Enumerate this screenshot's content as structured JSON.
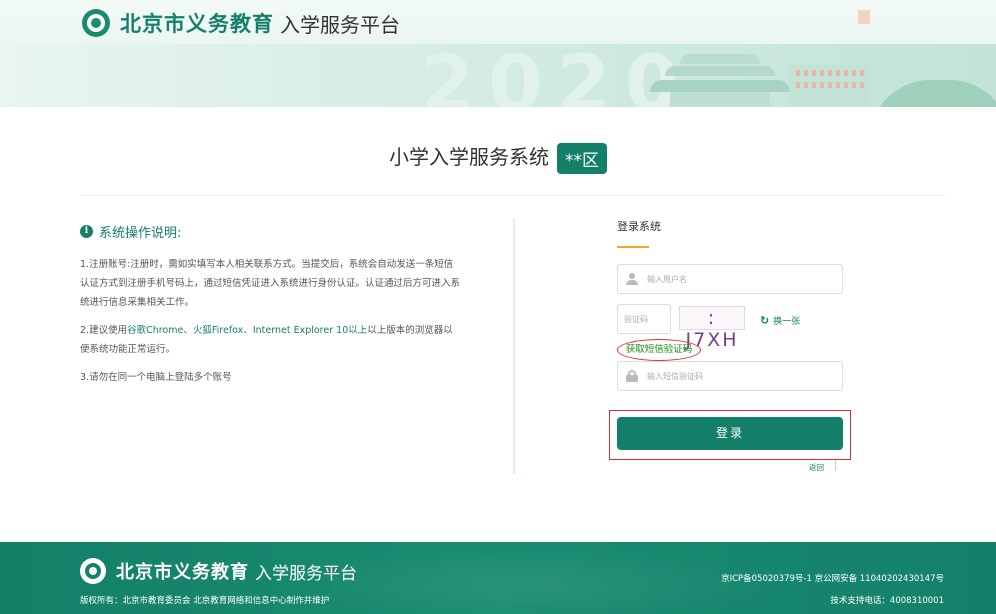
{
  "header": {
    "brand_strong": "北京市义务教育",
    "brand_light": "入学服务平台",
    "year_watermark": "2020"
  },
  "title": {
    "text": "小学入学服务系统",
    "district": "**区"
  },
  "instructions": {
    "heading": "系统操作说明:",
    "item1": "1.注册账号:注册时，需如实填写本人相关联系方式。当提交后，系统会自动发送一条短信认证方式到注册手机号码上，通过短信凭证进入系统进行身份认证。认证通过后方可进入系统进行信息采集相关工作。",
    "item2_prefix": "2.建议使用",
    "item2_chrome": "谷歌Chrome",
    "item2_sep1": "、",
    "item2_firefox": "火狐Firefox",
    "item2_sep2": "、",
    "item2_ie": "Internet Explorer 10以上",
    "item2_suffix": "以上版本的浏览器以便系统功能正常运行。",
    "item3": "3.请勿在同一个电脑上登陆多个账号"
  },
  "login": {
    "title": "登录系统",
    "username_placeholder": "输入用户名",
    "captcha_placeholder": "验证码",
    "captcha_text": ": J7XH",
    "refresh_label": "换一张",
    "sms_link": "获取短信验证码",
    "sms_placeholder": "输入短信验证码",
    "submit": "登录",
    "back": "返回"
  },
  "footer": {
    "brand_strong": "北京市义务教育",
    "brand_light": "入学服务平台",
    "copyright": "版权所有：北京市教育委员会 北京教育网络和信息中心制作并维护",
    "icp": "京ICP备05020379号-1 京公网安备 11040202430147号",
    "support": "技术支持电话：4008310001"
  },
  "colors": {
    "brand_green": "#14806a",
    "highlight_red": "#d9302f",
    "accent_orange": "#f5a623"
  }
}
